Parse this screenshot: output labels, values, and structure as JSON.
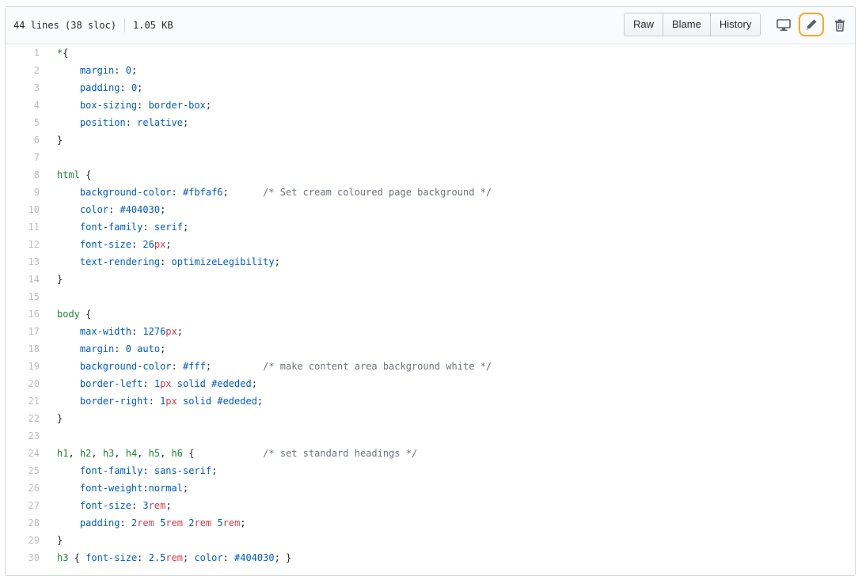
{
  "header": {
    "lines": "44 lines (38 sloc)",
    "size": "1.05 KB",
    "raw_label": "Raw",
    "blame_label": "Blame",
    "history_label": "History"
  },
  "icons": {
    "desktop": "desktop-icon",
    "edit": "pencil-icon",
    "trash": "trash-icon"
  },
  "colors": {
    "edit_highlight": "#f9a825",
    "selector": "#22863a",
    "property": "#005cc5",
    "unit": "#d73a49",
    "comment": "#6a737d"
  },
  "code_lines": [
    {
      "n": "1",
      "t": [
        [
          "sel",
          "*"
        ],
        [
          "",
          "{"
        ]
      ]
    },
    {
      "n": "2",
      "t": [
        [
          "",
          "    "
        ],
        [
          "prop",
          "margin"
        ],
        [
          "",
          ": "
        ],
        [
          "val",
          "0"
        ],
        [
          "",
          ";"
        ]
      ]
    },
    {
      "n": "3",
      "t": [
        [
          "",
          "    "
        ],
        [
          "prop",
          "padding"
        ],
        [
          "",
          ": "
        ],
        [
          "val",
          "0"
        ],
        [
          "",
          ";"
        ]
      ]
    },
    {
      "n": "4",
      "t": [
        [
          "",
          "    "
        ],
        [
          "prop",
          "box-sizing"
        ],
        [
          "",
          ": "
        ],
        [
          "val",
          "border-box"
        ],
        [
          "",
          ";"
        ]
      ]
    },
    {
      "n": "5",
      "t": [
        [
          "",
          "    "
        ],
        [
          "prop",
          "position"
        ],
        [
          "",
          ": "
        ],
        [
          "val",
          "relative"
        ],
        [
          "",
          ";"
        ]
      ]
    },
    {
      "n": "6",
      "t": [
        [
          "",
          "}"
        ]
      ]
    },
    {
      "n": "7",
      "t": []
    },
    {
      "n": "8",
      "t": [
        [
          "sel",
          "html"
        ],
        [
          "",
          " {"
        ]
      ]
    },
    {
      "n": "9",
      "t": [
        [
          "",
          "    "
        ],
        [
          "prop",
          "background-color"
        ],
        [
          "",
          ": "
        ],
        [
          "val",
          "#fbfaf6"
        ],
        [
          "",
          ";      "
        ],
        [
          "com",
          "/* Set cream coloured page background */"
        ]
      ]
    },
    {
      "n": "10",
      "t": [
        [
          "",
          "    "
        ],
        [
          "prop",
          "color"
        ],
        [
          "",
          ": "
        ],
        [
          "val",
          "#404030"
        ],
        [
          "",
          ";"
        ]
      ]
    },
    {
      "n": "11",
      "t": [
        [
          "",
          "    "
        ],
        [
          "prop",
          "font-family"
        ],
        [
          "",
          ": "
        ],
        [
          "val",
          "serif"
        ],
        [
          "",
          ";"
        ]
      ]
    },
    {
      "n": "12",
      "t": [
        [
          "",
          "    "
        ],
        [
          "prop",
          "font-size"
        ],
        [
          "",
          ": "
        ],
        [
          "val",
          "26"
        ],
        [
          "unit",
          "px"
        ],
        [
          "",
          ";"
        ]
      ]
    },
    {
      "n": "13",
      "t": [
        [
          "",
          "    "
        ],
        [
          "prop",
          "text-rendering"
        ],
        [
          "",
          ": "
        ],
        [
          "val",
          "optimizeLegibility"
        ],
        [
          "",
          ";"
        ]
      ]
    },
    {
      "n": "14",
      "t": [
        [
          "",
          "}"
        ]
      ]
    },
    {
      "n": "15",
      "t": []
    },
    {
      "n": "16",
      "t": [
        [
          "sel",
          "body"
        ],
        [
          "",
          " {"
        ]
      ]
    },
    {
      "n": "17",
      "t": [
        [
          "",
          "    "
        ],
        [
          "prop",
          "max-width"
        ],
        [
          "",
          ": "
        ],
        [
          "val",
          "1276"
        ],
        [
          "unit",
          "px"
        ],
        [
          "",
          ";"
        ]
      ]
    },
    {
      "n": "18",
      "t": [
        [
          "",
          "    "
        ],
        [
          "prop",
          "margin"
        ],
        [
          "",
          ": "
        ],
        [
          "val",
          "0"
        ],
        [
          "",
          " "
        ],
        [
          "val",
          "auto"
        ],
        [
          "",
          ";"
        ]
      ]
    },
    {
      "n": "19",
      "t": [
        [
          "",
          "    "
        ],
        [
          "prop",
          "background-color"
        ],
        [
          "",
          ": "
        ],
        [
          "val",
          "#fff"
        ],
        [
          "",
          ";         "
        ],
        [
          "com",
          "/* make content area background white */"
        ]
      ]
    },
    {
      "n": "20",
      "t": [
        [
          "",
          "    "
        ],
        [
          "prop",
          "border-left"
        ],
        [
          "",
          ": "
        ],
        [
          "val",
          "1"
        ],
        [
          "unit",
          "px"
        ],
        [
          "",
          " "
        ],
        [
          "val",
          "solid"
        ],
        [
          "",
          " "
        ],
        [
          "val",
          "#ededed"
        ],
        [
          "",
          ";"
        ]
      ]
    },
    {
      "n": "21",
      "t": [
        [
          "",
          "    "
        ],
        [
          "prop",
          "border-right"
        ],
        [
          "",
          ": "
        ],
        [
          "val",
          "1"
        ],
        [
          "unit",
          "px"
        ],
        [
          "",
          " "
        ],
        [
          "val",
          "solid"
        ],
        [
          "",
          " "
        ],
        [
          "val",
          "#ededed"
        ],
        [
          "",
          ";"
        ]
      ]
    },
    {
      "n": "22",
      "t": [
        [
          "",
          "}"
        ]
      ]
    },
    {
      "n": "23",
      "t": []
    },
    {
      "n": "24",
      "t": [
        [
          "sel",
          "h1"
        ],
        [
          "",
          ", "
        ],
        [
          "sel",
          "h2"
        ],
        [
          "",
          ", "
        ],
        [
          "sel",
          "h3"
        ],
        [
          "",
          ", "
        ],
        [
          "sel",
          "h4"
        ],
        [
          "",
          ", "
        ],
        [
          "sel",
          "h5"
        ],
        [
          "",
          ", "
        ],
        [
          "sel",
          "h6"
        ],
        [
          "",
          " {            "
        ],
        [
          "com",
          "/* set standard headings */"
        ]
      ]
    },
    {
      "n": "25",
      "t": [
        [
          "",
          "    "
        ],
        [
          "prop",
          "font-family"
        ],
        [
          "",
          ": "
        ],
        [
          "val",
          "sans-serif"
        ],
        [
          "",
          ";"
        ]
      ]
    },
    {
      "n": "26",
      "t": [
        [
          "",
          "    "
        ],
        [
          "prop",
          "font-weight"
        ],
        [
          "",
          ":"
        ],
        [
          "val",
          "normal"
        ],
        [
          "",
          ";"
        ]
      ]
    },
    {
      "n": "27",
      "t": [
        [
          "",
          "    "
        ],
        [
          "prop",
          "font-size"
        ],
        [
          "",
          ": "
        ],
        [
          "val",
          "3"
        ],
        [
          "unit",
          "rem"
        ],
        [
          "",
          ";"
        ]
      ]
    },
    {
      "n": "28",
      "t": [
        [
          "",
          "    "
        ],
        [
          "prop",
          "padding"
        ],
        [
          "",
          ": "
        ],
        [
          "val",
          "2"
        ],
        [
          "unit",
          "rem"
        ],
        [
          "",
          " "
        ],
        [
          "val",
          "5"
        ],
        [
          "unit",
          "rem"
        ],
        [
          "",
          " "
        ],
        [
          "val",
          "2"
        ],
        [
          "unit",
          "rem"
        ],
        [
          "",
          " "
        ],
        [
          "val",
          "5"
        ],
        [
          "unit",
          "rem"
        ],
        [
          "",
          ";"
        ]
      ]
    },
    {
      "n": "29",
      "t": [
        [
          "",
          "}"
        ]
      ]
    },
    {
      "n": "30",
      "t": [
        [
          "sel",
          "h3"
        ],
        [
          "",
          " { "
        ],
        [
          "prop",
          "font-size"
        ],
        [
          "",
          ": "
        ],
        [
          "val",
          "2.5"
        ],
        [
          "unit",
          "rem"
        ],
        [
          "",
          "; "
        ],
        [
          "prop",
          "color"
        ],
        [
          "",
          ": "
        ],
        [
          "val",
          "#404030"
        ],
        [
          "",
          "; }"
        ]
      ]
    }
  ]
}
